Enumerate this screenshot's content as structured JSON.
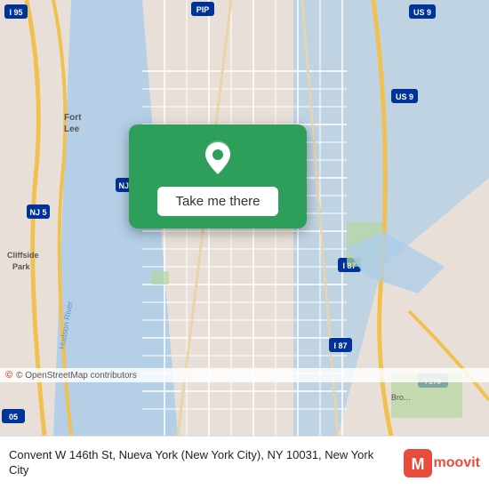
{
  "map": {
    "attribution": "© OpenStreetMap contributors",
    "card": {
      "button_label": "Take me there"
    }
  },
  "bottom_bar": {
    "address": "Convent W 146th St, Nueva York (New York City), NY 10031, New York City",
    "brand": "moovit"
  }
}
